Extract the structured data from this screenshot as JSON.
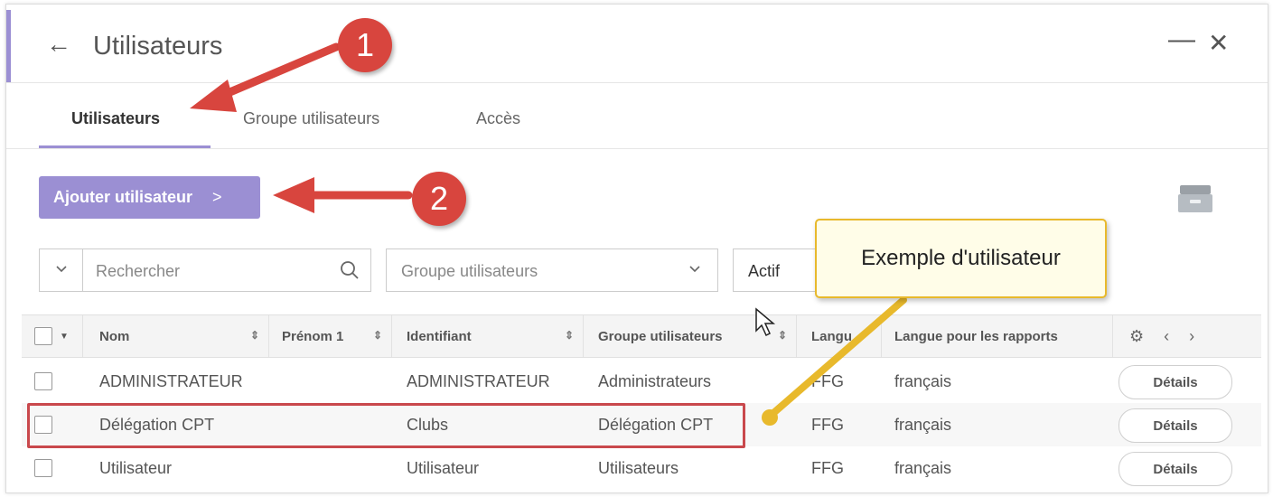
{
  "header": {
    "title": "Utilisateurs"
  },
  "tabs": [
    {
      "label": "Utilisateurs",
      "active": true
    },
    {
      "label": "Groupe utilisateurs",
      "active": false
    },
    {
      "label": "Accès",
      "active": false
    }
  ],
  "toolbar": {
    "add_label": "Ajouter utilisateur",
    "add_chevron": ">"
  },
  "filters": {
    "search_placeholder": "Rechercher",
    "group_placeholder": "Groupe utilisateurs",
    "status_value": "Actif"
  },
  "table": {
    "columns": [
      "Nom",
      "Prénom 1",
      "Identifiant",
      "Groupe utilisateurs",
      "Langu",
      "Langue pour les rapports"
    ],
    "rows": [
      {
        "nom": "ADMINISTRATEUR",
        "prenom": "",
        "identifiant": "ADMINISTRATEUR",
        "groupe": "Administrateurs",
        "langue": "FFG",
        "langue_rapports": "français",
        "action": "Détails"
      },
      {
        "nom": "Délégation CPT",
        "prenom": "",
        "identifiant": "Clubs",
        "groupe": "Délégation CPT",
        "langue": "FFG",
        "langue_rapports": "français",
        "action": "Détails"
      },
      {
        "nom": "Utilisateur",
        "prenom": "",
        "identifiant": "Utilisateur",
        "groupe": "Utilisateurs",
        "langue": "FFG",
        "langue_rapports": "français",
        "action": "Détails"
      }
    ]
  },
  "annotations": {
    "badge_1": "1",
    "badge_2": "2",
    "callout": "Exemple d'utilisateur"
  },
  "colors": {
    "accent": "#9b8fd3",
    "annotation_red": "#d8453e",
    "callout_border": "#e8b92c"
  },
  "icons": [
    "back-arrow-icon",
    "minimize-icon",
    "close-icon",
    "archive-icon",
    "chevron-down-icon",
    "search-icon",
    "sort-icon",
    "gear-icon",
    "chevron-left-icon",
    "chevron-right-icon",
    "cursor-icon"
  ]
}
